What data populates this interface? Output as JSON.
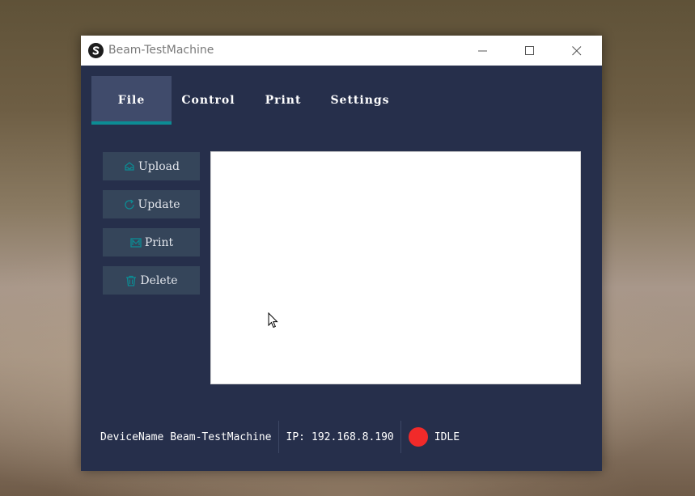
{
  "window": {
    "title": "Beam-TestMachine"
  },
  "tabs": [
    {
      "label": "File",
      "active": true
    },
    {
      "label": "Control",
      "active": false
    },
    {
      "label": "Print",
      "active": false
    },
    {
      "label": "Settings",
      "active": false
    }
  ],
  "sidebar": {
    "buttons": [
      {
        "label": "Upload",
        "icon": "upload-icon"
      },
      {
        "label": "Update",
        "icon": "refresh-icon"
      },
      {
        "label": "Print",
        "icon": "print-icon"
      },
      {
        "label": "Delete",
        "icon": "trash-icon"
      }
    ]
  },
  "status": {
    "device_label": "DeviceName",
    "device_name": "Beam-TestMachine",
    "ip_label": "IP:",
    "ip_value": "192.168.8.190",
    "state": "IDLE",
    "state_color": "#f12a2a"
  },
  "colors": {
    "window_bg": "#262f4b",
    "tab_active_bg": "#404b6b",
    "tab_underline": "#0c8c94",
    "button_bg": "#35455a",
    "icon_accent": "#0c8c94"
  }
}
